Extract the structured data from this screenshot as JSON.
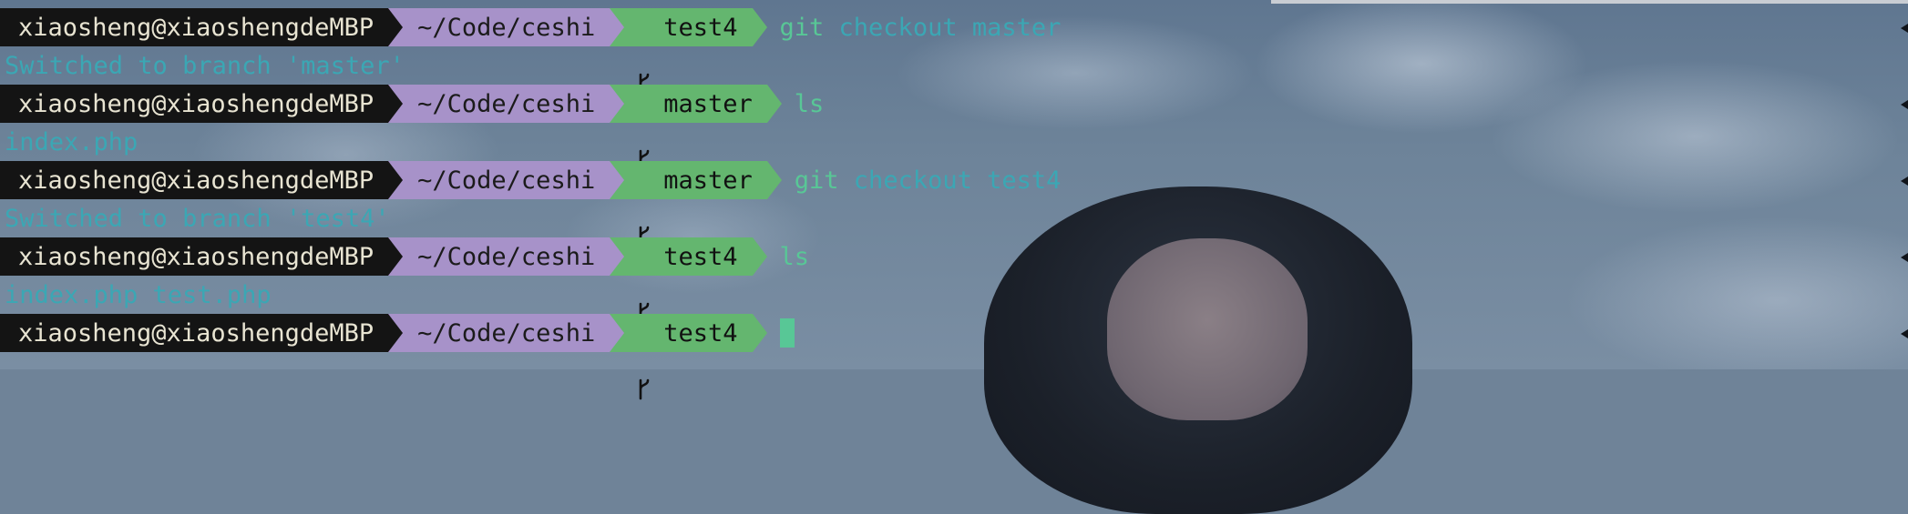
{
  "prompt": {
    "user_host": "xiaosheng@xiaoshengdeMBP",
    "dir": "~/Code/ceshi"
  },
  "icons": {
    "branch": "git-branch-icon"
  },
  "colors": {
    "user_segment": "#141414",
    "dir_segment": "#a792c9",
    "branch_segment": "#64b66f",
    "command": "#58c796",
    "output": "#3ba7b4"
  },
  "lines": [
    {
      "branch": "test4",
      "cmd": "git",
      "args": " checkout master"
    },
    {
      "output": "Switched to branch 'master'"
    },
    {
      "branch": "master",
      "cmd": "ls",
      "args": ""
    },
    {
      "output": "index.php"
    },
    {
      "branch": "master",
      "cmd": "git",
      "args": " checkout test4"
    },
    {
      "output": "Switched to branch 'test4'"
    },
    {
      "branch": "test4",
      "cmd": "ls",
      "args": ""
    },
    {
      "output": "index.php test.php"
    },
    {
      "branch": "test4",
      "cmd": "",
      "args": ""
    }
  ]
}
